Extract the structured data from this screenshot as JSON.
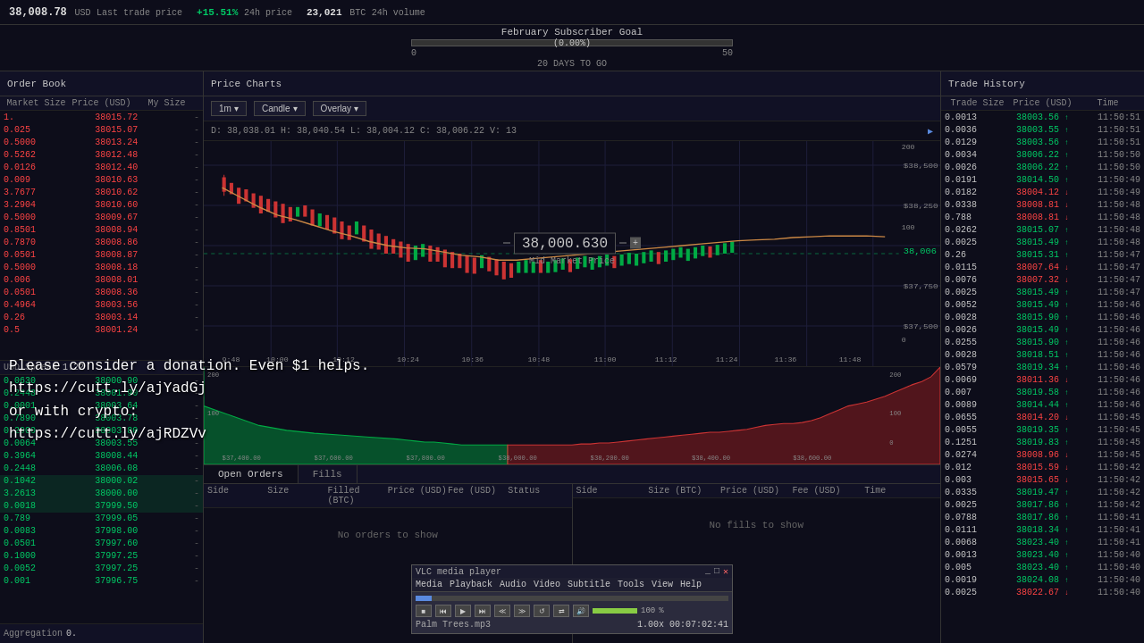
{
  "topbar": {
    "price": "38,008.78",
    "currency": "USD",
    "last_label": "Last trade price",
    "change": "+15.51%",
    "change_label": "24h price",
    "volume": "23,021",
    "vol_currency": "BTC",
    "vol_label": "24h volume"
  },
  "goal": {
    "title": "February Subscriber Goal",
    "current": "0",
    "pct": "(0.00%)",
    "max": "50",
    "days": "20 DAYS TO GO",
    "bar_width": "0"
  },
  "orderbook": {
    "title": "Order Book",
    "col_market_size": "Market Size",
    "col_price": "Price (USD)",
    "col_my_size": "My Size",
    "asks": [
      {
        "size": "1.",
        "price": "38015.72",
        "my_size": "-"
      },
      {
        "size": "0.025",
        "price": "38015.07",
        "my_size": "-"
      },
      {
        "size": "0.5000",
        "price": "38013.24",
        "my_size": "-"
      },
      {
        "size": "0.5262",
        "price": "38012.48",
        "my_size": "-"
      },
      {
        "size": "0.0126",
        "price": "38012.40",
        "my_size": "-"
      },
      {
        "size": "0.009",
        "price": "38010.63",
        "my_size": "-"
      },
      {
        "size": "3.7677",
        "price": "38010.62",
        "my_size": "-"
      },
      {
        "size": "3.2904",
        "price": "38010.60",
        "my_size": "-"
      },
      {
        "size": "0.5000",
        "price": "38009.67",
        "my_size": "-"
      },
      {
        "size": "0.8501",
        "price": "38008.94",
        "my_size": "-"
      },
      {
        "size": "0.7870",
        "price": "38008.86",
        "my_size": "-"
      },
      {
        "size": "0.0501",
        "price": "38008.87",
        "my_size": "-"
      },
      {
        "size": "0.5000",
        "price": "38008.18",
        "my_size": "-"
      },
      {
        "size": "0.006",
        "price": "38008.01",
        "my_size": "-"
      },
      {
        "size": "0.0501",
        "price": "38008.36",
        "my_size": "-"
      },
      {
        "size": "0.4964",
        "price": "38003.56",
        "my_size": "-"
      },
      {
        "size": "0.26",
        "price": "38003.14",
        "my_size": "-"
      },
      {
        "size": "0.5",
        "price": "38001.24",
        "my_size": "-"
      }
    ],
    "spread_label": "USD Spread",
    "spread_val": "1.22",
    "bids": [
      {
        "size": "0.0630",
        "price": "38000.90",
        "my_size": "-"
      },
      {
        "size": "0.2448",
        "price": "38001.90",
        "my_size": "-"
      },
      {
        "size": "0.0001",
        "price": "38003.64",
        "my_size": "-"
      },
      {
        "size": "0.7890",
        "price": "38003.78",
        "my_size": "-"
      },
      {
        "size": "0.2900",
        "price": "38003.80",
        "my_size": "-"
      },
      {
        "size": "0.0064",
        "price": "38003.55",
        "my_size": "-"
      },
      {
        "size": "0.3964",
        "price": "38008.44",
        "my_size": "-"
      },
      {
        "size": "0.2448",
        "price": "38006.08",
        "my_size": "-"
      },
      {
        "size": "0.1042",
        "price": "38000.02",
        "my_size": "-"
      },
      {
        "size": "3.2613",
        "price": "38000.00",
        "my_size": "-"
      },
      {
        "size": "0.0018",
        "price": "37999.50",
        "my_size": "-"
      },
      {
        "size": "0.789",
        "price": "37999.05",
        "my_size": "-"
      },
      {
        "size": "0.0083",
        "price": "37998.00",
        "my_size": "-"
      },
      {
        "size": "0.0501",
        "price": "37997.60",
        "my_size": "-"
      },
      {
        "size": "0.1000",
        "price": "37997.25",
        "my_size": "-"
      },
      {
        "size": "0.0052",
        "price": "37997.25",
        "my_size": "-"
      },
      {
        "size": "0.001",
        "price": "37996.75",
        "my_size": "-"
      }
    ],
    "aggregation_label": "Aggregation",
    "aggregation_val": "0."
  },
  "pricechart": {
    "title": "Price Charts",
    "timeframe": "1m",
    "chart_type": "Candle",
    "overlay": "Overlay",
    "chart_info": "D: 38,038.01  H: 38,040.54  L: 38,004.12  C: 38,006.22  V: 13",
    "mid_price": "38,000.630",
    "mid_price_label": "Mid Market Price",
    "time_labels": [
      "9:48",
      "10:00",
      "10:12",
      "10:24",
      "10:36",
      "10:48",
      "11:00",
      "11:12",
      "11:24",
      "11:36",
      "11:48"
    ],
    "price_labels": [
      "$38,500",
      "$38,250",
      "$38,006",
      "$37,750",
      "$37,500"
    ],
    "price_labels_right": [
      "200",
      "100",
      "0"
    ],
    "depth_labels": [
      "$37,400.00",
      "$37,600.00",
      "$37,800.00",
      "$38,000.00",
      "$38,200.00",
      "$38,400.00",
      "$38,600.00"
    ]
  },
  "bottompanels": {
    "tab_open_orders": "Open Orders",
    "tab_fills": "Fills",
    "open_orders_cols": [
      "Side",
      "Size",
      "Filled (BTC)",
      "Price (USD)",
      "Fee (USD)",
      "Status"
    ],
    "open_orders_empty": "No orders to show",
    "fills_cols": [
      "Side",
      "Size (BTC)",
      "Price (USD)",
      "Fee (USD)",
      "Time"
    ],
    "fills_empty": "No fills to show"
  },
  "tradehistory": {
    "title": "Trade History",
    "col_size": "Trade Size",
    "col_price": "Price (USD)",
    "col_time": "Time",
    "trades": [
      {
        "size": "0.0013",
        "price": "38003.56",
        "dir": "up",
        "time": "11:50:51"
      },
      {
        "size": "0.0036",
        "price": "38003.55",
        "dir": "up",
        "time": "11:50:51"
      },
      {
        "size": "0.0129",
        "price": "38003.56",
        "dir": "up",
        "time": "11:50:51"
      },
      {
        "size": "0.0034",
        "price": "38006.22",
        "dir": "up",
        "time": "11:50:50"
      },
      {
        "size": "0.0026",
        "price": "38006.22",
        "dir": "up",
        "time": "11:50:50"
      },
      {
        "size": "0.0191",
        "price": "38014.50",
        "dir": "up",
        "time": "11:50:49"
      },
      {
        "size": "0.0182",
        "price": "38004.12",
        "dir": "down",
        "time": "11:50:49"
      },
      {
        "size": "0.0338",
        "price": "38008.81",
        "dir": "down",
        "time": "11:50:48"
      },
      {
        "size": "0.788",
        "price": "38008.81",
        "dir": "down",
        "time": "11:50:48"
      },
      {
        "size": "0.0262",
        "price": "38015.07",
        "dir": "up",
        "time": "11:50:48"
      },
      {
        "size": "0.0025",
        "price": "38015.49",
        "dir": "up",
        "time": "11:50:48"
      },
      {
        "size": "0.26",
        "price": "38015.31",
        "dir": "up",
        "time": "11:50:47"
      },
      {
        "size": "0.0115",
        "price": "38007.64",
        "dir": "down",
        "time": "11:50:47"
      },
      {
        "size": "0.0076",
        "price": "38007.32",
        "dir": "down",
        "time": "11:50:47"
      },
      {
        "size": "0.0025",
        "price": "38015.49",
        "dir": "up",
        "time": "11:50:47"
      },
      {
        "size": "0.0052",
        "price": "38015.49",
        "dir": "up",
        "time": "11:50:46"
      },
      {
        "size": "0.0028",
        "price": "38015.90",
        "dir": "up",
        "time": "11:50:46"
      },
      {
        "size": "0.0026",
        "price": "38015.49",
        "dir": "up",
        "time": "11:50:46"
      },
      {
        "size": "0.0255",
        "price": "38015.90",
        "dir": "up",
        "time": "11:50:46"
      },
      {
        "size": "0.0028",
        "price": "38018.51",
        "dir": "up",
        "time": "11:50:46"
      },
      {
        "size": "0.0579",
        "price": "38019.34",
        "dir": "up",
        "time": "11:50:46"
      },
      {
        "size": "0.0069",
        "price": "38011.36",
        "dir": "down",
        "time": "11:50:46"
      },
      {
        "size": "0.007",
        "price": "38019.58",
        "dir": "up",
        "time": "11:50:46"
      },
      {
        "size": "0.0089",
        "price": "38014.44",
        "dir": "up",
        "time": "11:50:46"
      },
      {
        "size": "0.0655",
        "price": "38014.20",
        "dir": "down",
        "time": "11:50:45"
      },
      {
        "size": "0.0055",
        "price": "38019.35",
        "dir": "up",
        "time": "11:50:45"
      },
      {
        "size": "0.1251",
        "price": "38019.83",
        "dir": "up",
        "time": "11:50:45"
      },
      {
        "size": "0.0274",
        "price": "38008.96",
        "dir": "down",
        "time": "11:50:45"
      },
      {
        "size": "0.012",
        "price": "38015.59",
        "dir": "down",
        "time": "11:50:42"
      },
      {
        "size": "0.003",
        "price": "38015.65",
        "dir": "down",
        "time": "11:50:42"
      },
      {
        "size": "0.0335",
        "price": "38019.47",
        "dir": "up",
        "time": "11:50:42"
      },
      {
        "size": "0.0025",
        "price": "38017.86",
        "dir": "up",
        "time": "11:50:42"
      },
      {
        "size": "0.0788",
        "price": "38017.86",
        "dir": "up",
        "time": "11:50:41"
      },
      {
        "size": "0.0111",
        "price": "38018.34",
        "dir": "up",
        "time": "11:50:41"
      },
      {
        "size": "0.0068",
        "price": "38023.40",
        "dir": "up",
        "time": "11:50:41"
      },
      {
        "size": "0.0013",
        "price": "38023.40",
        "dir": "up",
        "time": "11:50:40"
      },
      {
        "size": "0.005",
        "price": "38023.40",
        "dir": "up",
        "time": "11:50:40"
      },
      {
        "size": "0.0019",
        "price": "38024.08",
        "dir": "up",
        "time": "11:50:40"
      },
      {
        "size": "0.0025",
        "price": "38022.67",
        "dir": "down",
        "time": "11:50:40"
      }
    ]
  },
  "donation": {
    "line1": "Please consider a donation. Even $1 helps.",
    "line2": "https://cutt.ly/ajYadGj",
    "line3": "or with crypto:",
    "line4": "https://cutt.ly/ajRDZVv"
  },
  "mediaplayer": {
    "menu_items": [
      "Media",
      "Playback",
      "Audio",
      "Video",
      "Subtitle",
      "Tools",
      "View",
      "Help"
    ],
    "filename": "Palm Trees.mp3",
    "time": "00:07:02:41",
    "speed": "1.00x",
    "progress_pct": "5",
    "vol_pct": "100"
  }
}
